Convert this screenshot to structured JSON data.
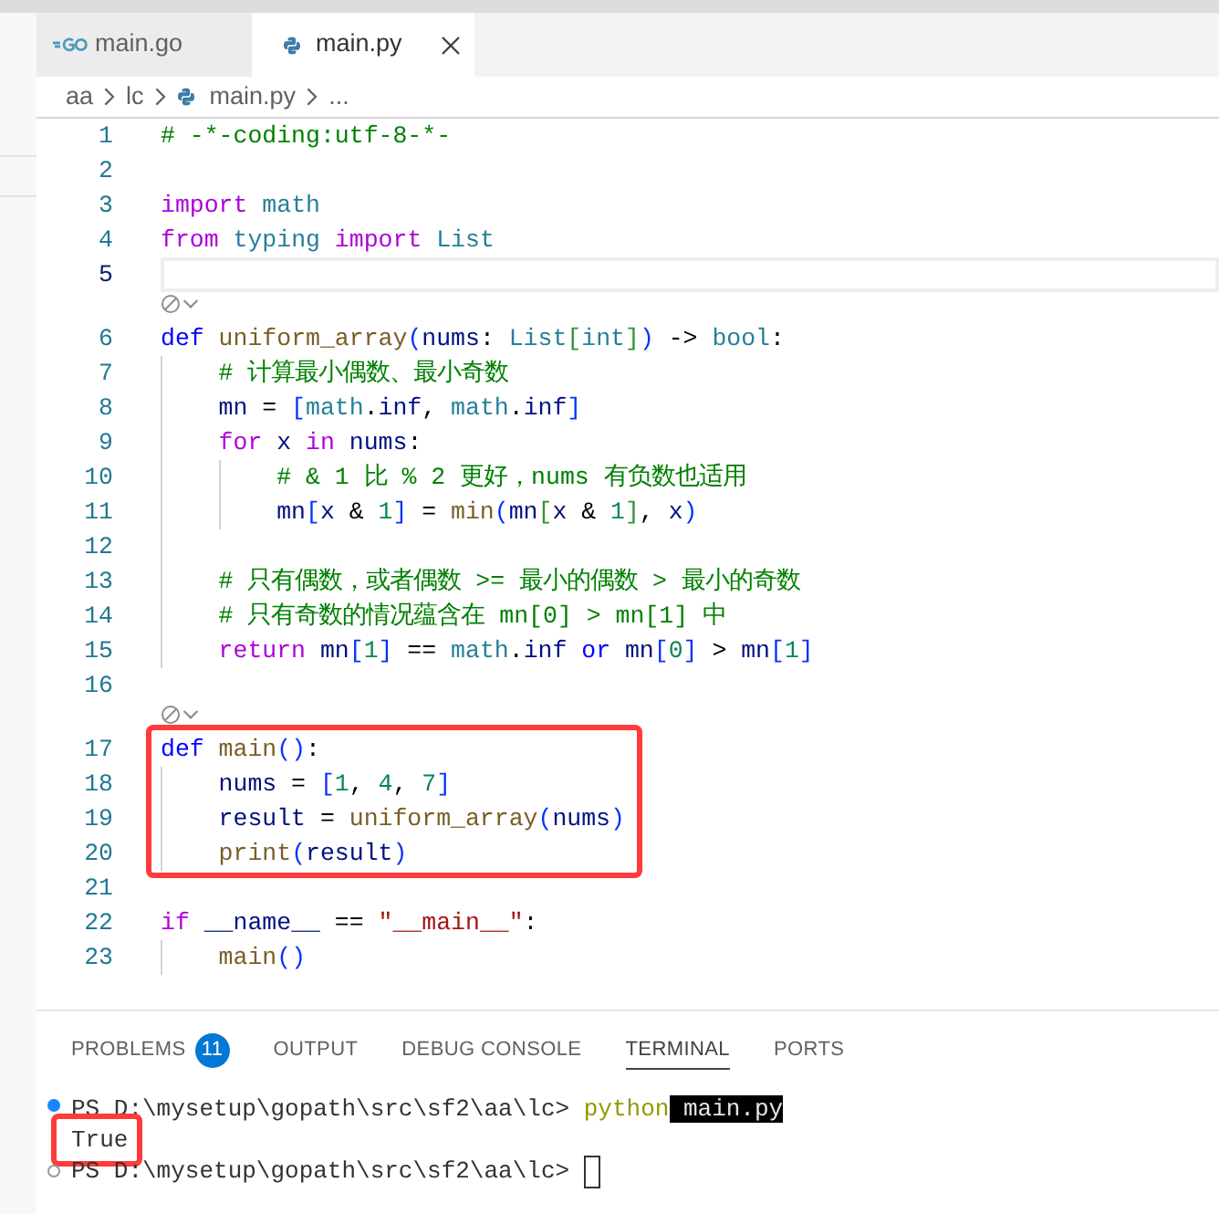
{
  "editor_tabs": [
    {
      "label": "main.go",
      "kind": "go",
      "selected": false
    },
    {
      "label": "main.py",
      "kind": "python",
      "selected": true
    }
  ],
  "breadcrumb": [
    {
      "text": "aa",
      "kind": "folder"
    },
    {
      "text": "lc",
      "kind": "folder"
    },
    {
      "text": "main.py",
      "kind": "python"
    },
    {
      "text": "...",
      "kind": "more"
    }
  ],
  "code_lines": [
    {
      "kind": "code",
      "number": "1",
      "current": false,
      "boxed": false,
      "tokens": [
        {
          "text": "# -*-coding:utf-8-*-",
          "kind": "comment"
        }
      ]
    },
    {
      "kind": "code",
      "number": "2",
      "current": false,
      "boxed": false
    },
    {
      "kind": "code",
      "number": "3",
      "current": false,
      "boxed": false,
      "tokens": [
        {
          "text": "import",
          "kind": "control"
        },
        {
          "text": " math",
          "kind": "type"
        }
      ]
    },
    {
      "kind": "code",
      "number": "4",
      "current": false,
      "boxed": false,
      "tokens": [
        {
          "text": "from",
          "kind": "control"
        },
        {
          "text": " typing",
          "kind": "type"
        },
        {
          "text": " import",
          "kind": "control"
        },
        {
          "text": " List",
          "kind": "type"
        }
      ]
    },
    {
      "kind": "code",
      "number": "5",
      "current": true,
      "boxed": false
    },
    {
      "kind": "codelens"
    },
    {
      "kind": "code",
      "number": "6",
      "current": false,
      "boxed": false,
      "tokens": [
        {
          "text": "def",
          "kind": "keyword"
        },
        {
          "text": " uniform_array",
          "kind": "function"
        },
        {
          "text": "(",
          "kind": "bracket"
        },
        {
          "text": "nums",
          "kind": "variable"
        },
        {
          "text": ":",
          "kind": "plain"
        },
        {
          "text": " List",
          "kind": "type"
        },
        {
          "text": "[",
          "kind": "bracket2"
        },
        {
          "text": "int",
          "kind": "type"
        },
        {
          "text": "]",
          "kind": "bracket2"
        },
        {
          "text": ")",
          "kind": "bracket"
        },
        {
          "text": " ->",
          "kind": "plain"
        },
        {
          "text": " bool",
          "kind": "type"
        },
        {
          "text": ":",
          "kind": "plain"
        }
      ],
      "children": [
        {
          "kind": "code",
          "number": "7",
          "current": false,
          "tokens": [
            {
              "text": "# 计算最小偶数、最小奇数",
              "kind": "comment"
            }
          ]
        },
        {
          "kind": "code",
          "number": "8",
          "current": false,
          "tokens": [
            {
              "text": "mn",
              "kind": "variable"
            },
            {
              "text": " =",
              "kind": "plain"
            },
            {
              "text": " [",
              "kind": "bracket"
            },
            {
              "text": "math",
              "kind": "type"
            },
            {
              "text": ".",
              "kind": "plain"
            },
            {
              "text": "inf",
              "kind": "variable"
            },
            {
              "text": ",",
              "kind": "plain"
            },
            {
              "text": " math",
              "kind": "type"
            },
            {
              "text": ".",
              "kind": "plain"
            },
            {
              "text": "inf",
              "kind": "variable"
            },
            {
              "text": "]",
              "kind": "bracket"
            }
          ]
        },
        {
          "kind": "code",
          "number": "9",
          "current": false,
          "tokens": [
            {
              "text": "for",
              "kind": "control"
            },
            {
              "text": " x",
              "kind": "variable"
            },
            {
              "text": " in",
              "kind": "control"
            },
            {
              "text": " nums",
              "kind": "variable"
            },
            {
              "text": ":",
              "kind": "plain"
            }
          ],
          "children": [
            {
              "kind": "code",
              "number": "10",
              "current": false,
              "tokens": [
                {
                  "text": "# & 1 比 % 2 更好，nums 有负数也适用",
                  "kind": "comment"
                }
              ]
            },
            {
              "kind": "code",
              "number": "11",
              "current": false,
              "tokens": [
                {
                  "text": "mn",
                  "kind": "variable"
                },
                {
                  "text": "[",
                  "kind": "bracket"
                },
                {
                  "text": "x",
                  "kind": "variable"
                },
                {
                  "text": " &",
                  "kind": "plain"
                },
                {
                  "text": " 1",
                  "kind": "number"
                },
                {
                  "text": "]",
                  "kind": "bracket"
                },
                {
                  "text": " =",
                  "kind": "plain"
                },
                {
                  "text": " min",
                  "kind": "function"
                },
                {
                  "text": "(",
                  "kind": "bracket"
                },
                {
                  "text": "mn",
                  "kind": "variable"
                },
                {
                  "text": "[",
                  "kind": "bracket2"
                },
                {
                  "text": "x",
                  "kind": "variable"
                },
                {
                  "text": " &",
                  "kind": "plain"
                },
                {
                  "text": " 1",
                  "kind": "number"
                },
                {
                  "text": "]",
                  "kind": "bracket2"
                },
                {
                  "text": ",",
                  "kind": "plain"
                },
                {
                  "text": " x",
                  "kind": "variable"
                },
                {
                  "text": ")",
                  "kind": "bracket"
                }
              ]
            }
          ]
        },
        {
          "kind": "code",
          "number": "12",
          "current": false
        },
        {
          "kind": "code",
          "number": "13",
          "current": false,
          "tokens": [
            {
              "text": "# 只有偶数，或者偶数 >= 最小的偶数 > 最小的奇数",
              "kind": "comment"
            }
          ]
        },
        {
          "kind": "code",
          "number": "14",
          "current": false,
          "tokens": [
            {
              "text": "# 只有奇数的情况蕴含在 mn[0] > mn[1] 中",
              "kind": "comment"
            }
          ]
        },
        {
          "kind": "code",
          "number": "15",
          "current": false,
          "tokens": [
            {
              "text": "return",
              "kind": "control"
            },
            {
              "text": " mn",
              "kind": "variable"
            },
            {
              "text": "[",
              "kind": "bracket"
            },
            {
              "text": "1",
              "kind": "number"
            },
            {
              "text": "]",
              "kind": "bracket"
            },
            {
              "text": " ==",
              "kind": "plain"
            },
            {
              "text": " math",
              "kind": "type"
            },
            {
              "text": ".",
              "kind": "plain"
            },
            {
              "text": "inf",
              "kind": "variable"
            },
            {
              "text": " or",
              "kind": "keyword"
            },
            {
              "text": " mn",
              "kind": "variable"
            },
            {
              "text": "[",
              "kind": "bracket"
            },
            {
              "text": "0",
              "kind": "number"
            },
            {
              "text": "]",
              "kind": "bracket"
            },
            {
              "text": " >",
              "kind": "plain"
            },
            {
              "text": " mn",
              "kind": "variable"
            },
            {
              "text": "[",
              "kind": "bracket"
            },
            {
              "text": "1",
              "kind": "number"
            },
            {
              "text": "]",
              "kind": "bracket"
            }
          ]
        }
      ]
    },
    {
      "kind": "code",
      "number": "16",
      "current": false,
      "boxed": false
    },
    {
      "kind": "codelens"
    },
    {
      "kind": "code",
      "number": "17",
      "current": false,
      "boxed": true,
      "tokens": [
        {
          "text": "def",
          "kind": "keyword"
        },
        {
          "text": " main",
          "kind": "function"
        },
        {
          "text": "(",
          "kind": "bracket"
        },
        {
          "text": ")",
          "kind": "bracket"
        },
        {
          "text": ":",
          "kind": "plain"
        }
      ],
      "children": [
        {
          "kind": "code",
          "number": "18",
          "current": false,
          "tokens": [
            {
              "text": "nums",
              "kind": "variable"
            },
            {
              "text": " =",
              "kind": "plain"
            },
            {
              "text": " [",
              "kind": "bracket"
            },
            {
              "text": "1",
              "kind": "number"
            },
            {
              "text": ",",
              "kind": "plain"
            },
            {
              "text": " 4",
              "kind": "number"
            },
            {
              "text": ",",
              "kind": "plain"
            },
            {
              "text": " 7",
              "kind": "number"
            },
            {
              "text": "]",
              "kind": "bracket"
            }
          ]
        },
        {
          "kind": "code",
          "number": "19",
          "current": false,
          "tokens": [
            {
              "text": "result",
              "kind": "variable"
            },
            {
              "text": " =",
              "kind": "plain"
            },
            {
              "text": " uniform_array",
              "kind": "function"
            },
            {
              "text": "(",
              "kind": "bracket"
            },
            {
              "text": "nums",
              "kind": "variable"
            },
            {
              "text": ")",
              "kind": "bracket"
            }
          ]
        },
        {
          "kind": "code",
          "number": "20",
          "current": false,
          "tokens": [
            {
              "text": "print",
              "kind": "function"
            },
            {
              "text": "(",
              "kind": "bracket"
            },
            {
              "text": "result",
              "kind": "variable"
            },
            {
              "text": ")",
              "kind": "bracket"
            }
          ]
        }
      ]
    },
    {
      "kind": "code",
      "number": "21",
      "current": false,
      "boxed": false
    },
    {
      "kind": "code",
      "number": "22",
      "current": false,
      "boxed": false,
      "tokens": [
        {
          "text": "if",
          "kind": "control"
        },
        {
          "text": " __name__",
          "kind": "variable"
        },
        {
          "text": " ==",
          "kind": "plain"
        },
        {
          "text": " \"__main__\"",
          "kind": "string"
        },
        {
          "text": ":",
          "kind": "plain"
        }
      ],
      "children": [
        {
          "kind": "code",
          "number": "23",
          "current": false,
          "tokens": [
            {
              "text": "main",
              "kind": "function"
            },
            {
              "text": "(",
              "kind": "bracket"
            },
            {
              "text": ")",
              "kind": "bracket"
            }
          ]
        }
      ]
    }
  ],
  "panel_tabs": [
    {
      "label": "PROBLEMS",
      "badge": "11",
      "selected": false
    },
    {
      "label": "OUTPUT",
      "selected": false
    },
    {
      "label": "DEBUG CONSOLE",
      "selected": false
    },
    {
      "label": "TERMINAL",
      "selected": true
    },
    {
      "label": "PORTS",
      "selected": false
    }
  ],
  "terminal_lines": [
    {
      "kind": "command",
      "boxed": false,
      "prompt": "PS D:\\mysetup\\gopath\\src\\sf2\\aa\\lc>",
      "command": [
        {
          "text": "python",
          "kind": "program",
          "selected": false
        },
        {
          "text": "main.py",
          "kind": "argument",
          "selected": true
        }
      ]
    },
    {
      "kind": "output",
      "boxed": true,
      "text": "True"
    },
    {
      "kind": "prompt",
      "boxed": false,
      "prompt": "PS D:\\mysetup\\gopath\\src\\sf2\\aa\\lc>",
      "cursor": true
    }
  ]
}
